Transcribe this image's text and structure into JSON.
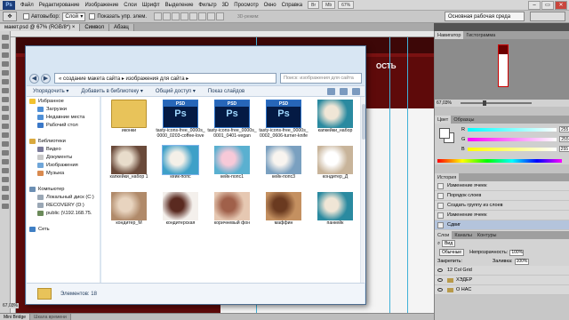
{
  "app": {
    "logo": "Ps"
  },
  "menu": [
    "Файл",
    "Редактирование",
    "Изображение",
    "Слои",
    "Шрифт",
    "Выделение",
    "Фильтр",
    "3D",
    "Просмотр",
    "Окно",
    "Справка"
  ],
  "menu_buttons": [
    "Br",
    "Mb",
    "67%"
  ],
  "window_controls": [
    "–",
    "▭",
    "✕"
  ],
  "options": {
    "autoselect": "Автовыбор:",
    "mode": "Слой",
    "transform": "Показать упр. элем.",
    "mode3d": "3D-режим:"
  },
  "workspace": {
    "label": "Основная рабочая среда"
  },
  "doc_tabs": [
    "макет.psd @ 67% (RGB/8*) ×",
    "Символ",
    "Абзац"
  ],
  "canvas": {
    "heading": "ОСТЬ"
  },
  "status": {
    "zoom": "67,03%",
    "mini_bridge": "Mini Bridge",
    "timeline": "Шкала времени"
  },
  "panels": {
    "navigator": {
      "tabs": [
        "Навигатор",
        "Гистограмма"
      ],
      "zoom": "67,03%"
    },
    "color": {
      "tabs": [
        "Цвет",
        "Образцы"
      ],
      "channels": [
        {
          "label": "R",
          "value": "255"
        },
        {
          "label": "G",
          "value": "255"
        },
        {
          "label": "B",
          "value": "255"
        }
      ]
    },
    "history": {
      "tabs": [
        "История"
      ],
      "items": [
        "Изменение ячеек",
        "Порядок слоев",
        "Создать группу из слоев",
        "Изменение ячеек",
        "Сдвиг"
      ]
    },
    "layers": {
      "tabs": [
        "Слои",
        "Каналы",
        "Контуры"
      ],
      "kind": "Вид",
      "blend": "Обычные",
      "opacity_label": "Непрозрачность:",
      "opacity": "100%",
      "lock_label": "Закрепить:",
      "fill_label": "Заливка:",
      "fill": "100%",
      "items": [
        "12 Col Grid",
        "ХЭДЕР",
        "О НАС"
      ]
    }
  },
  "explorer": {
    "path": "« создание макета сайта ▸ изображения для сайта ▸",
    "search_placeholder": "Поиск: изображения для сайта",
    "toolbar": [
      "Упорядочить ▾",
      "Добавить в библиотеку ▾",
      "Общий доступ ▾",
      "Показ слайдов"
    ],
    "tree": [
      {
        "label": "Избранное",
        "icon": "star-icon"
      },
      {
        "label": "Загрузки",
        "icon": "downloads-icon"
      },
      {
        "label": "Недавние места",
        "icon": "recent-places-icon"
      },
      {
        "label": "Рабочий стол",
        "icon": "desktop-icon"
      },
      {
        "label": "",
        "icon": "spacer"
      },
      {
        "label": "Библиотеки",
        "icon": "library-icon"
      },
      {
        "label": "Видео",
        "icon": "video-icon"
      },
      {
        "label": "Документы",
        "icon": "documents-icon"
      },
      {
        "label": "Изображения",
        "icon": "pictures-icon"
      },
      {
        "label": "Музыка",
        "icon": "music-icon"
      },
      {
        "label": "",
        "icon": "spacer"
      },
      {
        "label": "Компьютер",
        "icon": "computer-icon"
      },
      {
        "label": "Локальный диск (C:)",
        "icon": "drive-icon"
      },
      {
        "label": "RECOVERY (D:)",
        "icon": "drive-icon"
      },
      {
        "label": "public (\\\\192.168.75.",
        "icon": "network-drive-icon"
      },
      {
        "label": "",
        "icon": "spacer"
      },
      {
        "label": "Сеть",
        "icon": "network-icon"
      }
    ],
    "files": [
      {
        "label": "иконки",
        "kind": "folder"
      },
      {
        "label": "tasty-icons-free_0000s_0000_0203-coffee-love",
        "kind": "psd"
      },
      {
        "label": "tasty-icons-free_0000s_0001_0401-vegan",
        "kind": "psd"
      },
      {
        "label": "tasty-icons-free_0000s_0002_0606-turner-knife",
        "kind": "psd"
      },
      {
        "label": "капкейки_набор",
        "kind": "photo"
      },
      {
        "label": "капкейки_набор 1",
        "kind": "photo"
      },
      {
        "label": "кейк-попс",
        "kind": "photo"
      },
      {
        "label": "кейк-попс1",
        "kind": "photo"
      },
      {
        "label": "кейк-попс3",
        "kind": "photo"
      },
      {
        "label": "кондитер_Д",
        "kind": "photo"
      },
      {
        "label": "кондитер_М",
        "kind": "photo"
      },
      {
        "label": "кондитерская",
        "kind": "photo"
      },
      {
        "label": "коричневый фон",
        "kind": "photo"
      },
      {
        "label": "маффин",
        "kind": "photo"
      },
      {
        "label": "панкейк",
        "kind": "photo"
      }
    ],
    "status": "Элементов: 18"
  },
  "colors": {
    "accent": "#5e0a0a",
    "explorer_frame": "#d8e6f3",
    "selection": "#b4c4dc"
  }
}
